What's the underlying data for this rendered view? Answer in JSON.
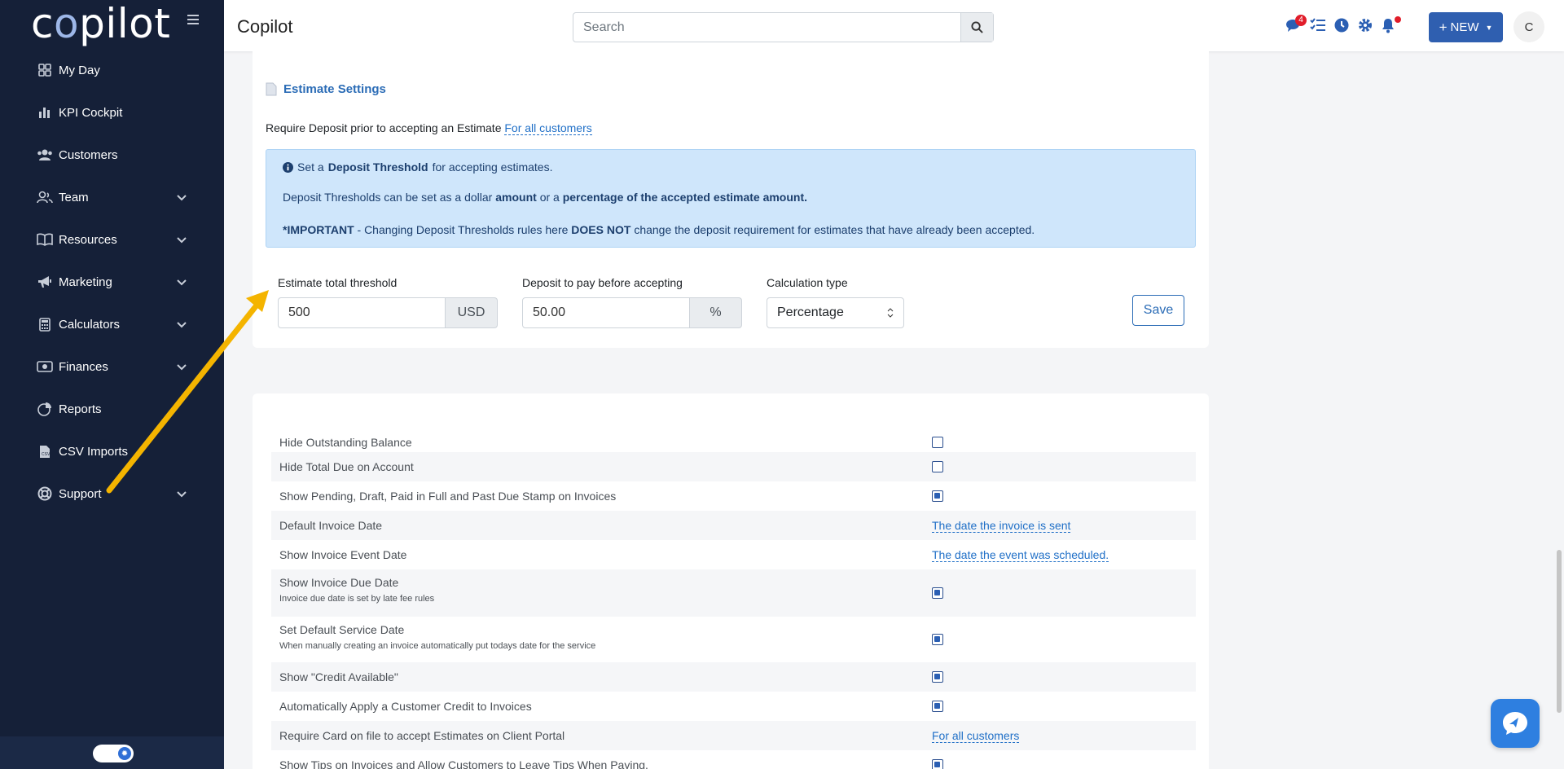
{
  "app": {
    "logo_left": "c",
    "logo_o": "o",
    "logo_right": "pilot",
    "title": "Copilot"
  },
  "header": {
    "search_placeholder": "Search",
    "messages_badge": "4",
    "new_button": "NEW",
    "avatar_initial": "C"
  },
  "sidebar": {
    "items": [
      {
        "label": "My Day",
        "icon": "grid-icon",
        "expandable": false
      },
      {
        "label": "KPI Cockpit",
        "icon": "bar-chart-icon",
        "expandable": false
      },
      {
        "label": "Customers",
        "icon": "users-icon",
        "expandable": false
      },
      {
        "label": "Team",
        "icon": "team-icon",
        "expandable": true
      },
      {
        "label": "Resources",
        "icon": "book-icon",
        "expandable": true
      },
      {
        "label": "Marketing",
        "icon": "megaphone-icon",
        "expandable": true
      },
      {
        "label": "Calculators",
        "icon": "calculator-icon",
        "expandable": true
      },
      {
        "label": "Finances",
        "icon": "money-icon",
        "expandable": true
      },
      {
        "label": "Reports",
        "icon": "pie-chart-icon",
        "expandable": false
      },
      {
        "label": "CSV Imports",
        "icon": "file-csv-icon",
        "expandable": false
      },
      {
        "label": "Support",
        "icon": "lifebuoy-icon",
        "expandable": true
      }
    ]
  },
  "estimate": {
    "section_title": "Estimate Settings",
    "require_deposit_text": "Require Deposit prior to accepting an Estimate",
    "require_deposit_link": "For all customers",
    "alert": {
      "line1_pre": "Set a",
      "line1_bold": "Deposit Threshold",
      "line1_post": "for accepting estimates.",
      "line2_pre": "Deposit Thresholds can be set as a dollar",
      "line2_bold1": "amount",
      "line2_mid": "or a",
      "line2_bold2": "percentage of the accepted estimate amount.",
      "line3_bold1": "*IMPORTANT",
      "line3_mid": "- Changing Deposit Thresholds rules here",
      "line3_bold2": "DOES NOT",
      "line3_post": "change the deposit requirement for estimates that have already been accepted."
    },
    "threshold_label": "Estimate total threshold",
    "threshold_value": "500",
    "threshold_unit": "USD",
    "deposit_label": "Deposit to pay before accepting",
    "deposit_value": "50.00",
    "deposit_unit": "%",
    "calc_label": "Calculation type",
    "calc_value": "Percentage",
    "save_label": "Save"
  },
  "invoice_settings": [
    {
      "label": "Hide Outstanding Balance",
      "type": "checkbox",
      "checked": false
    },
    {
      "label": "Hide Total Due on Account",
      "type": "checkbox",
      "checked": false
    },
    {
      "label": "Show Pending, Draft, Paid in Full and Past Due Stamp on Invoices",
      "type": "checkbox",
      "checked": true
    },
    {
      "label": "Default Invoice Date",
      "type": "link",
      "value": "The date the invoice is sent"
    },
    {
      "label": "Show Invoice Event Date",
      "type": "link",
      "value": "The date the event was scheduled."
    },
    {
      "label": "Show Invoice Due Date",
      "sublabel": "Invoice due date is set by late fee rules",
      "type": "checkbox",
      "checked": true
    },
    {
      "label": "Set Default Service Date",
      "sublabel": "When manually creating an invoice automatically put todays date for the service",
      "type": "checkbox",
      "checked": true
    },
    {
      "label": "Show \"Credit Available\"",
      "type": "checkbox",
      "checked": true
    },
    {
      "label": "Automatically Apply a Customer Credit to Invoices",
      "type": "checkbox",
      "checked": true
    },
    {
      "label": "Require Card on file to accept Estimates on Client Portal",
      "type": "link",
      "value": "For all customers"
    },
    {
      "label": "Show Tips on Invoices and Allow Customers to Leave Tips When Paying.",
      "type": "checkbox",
      "checked": true
    }
  ],
  "colors": {
    "sidebar_bg": "#152038",
    "accent": "#2b6cb6",
    "alert_bg": "#cfe6fb",
    "arrow": "#f4b400"
  }
}
